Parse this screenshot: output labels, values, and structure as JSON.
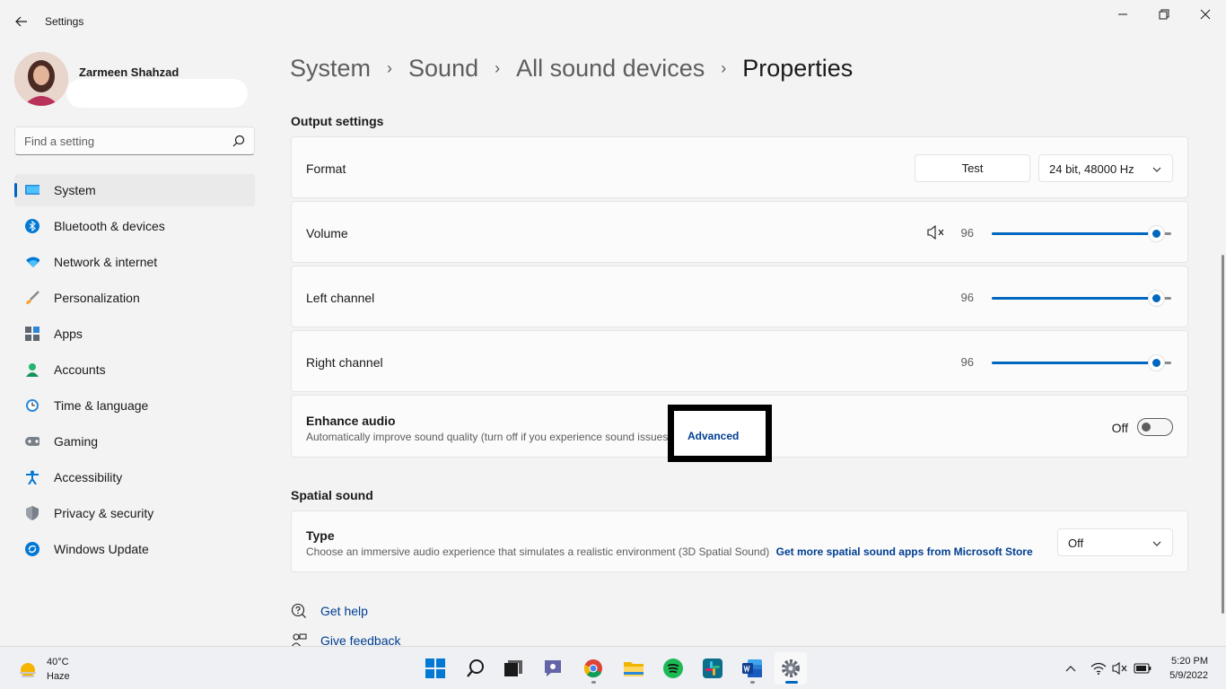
{
  "window": {
    "title": "Settings"
  },
  "profile": {
    "name": "Zarmeen Shahzad"
  },
  "search": {
    "placeholder": "Find a setting"
  },
  "sidebar": {
    "items": [
      {
        "label": "System",
        "icon": "system-icon",
        "active": true
      },
      {
        "label": "Bluetooth & devices",
        "icon": "bluetooth-icon"
      },
      {
        "label": "Network & internet",
        "icon": "wifi-icon"
      },
      {
        "label": "Personalization",
        "icon": "brush-icon"
      },
      {
        "label": "Apps",
        "icon": "apps-icon"
      },
      {
        "label": "Accounts",
        "icon": "accounts-icon"
      },
      {
        "label": "Time & language",
        "icon": "clock-globe-icon"
      },
      {
        "label": "Gaming",
        "icon": "gamepad-icon"
      },
      {
        "label": "Accessibility",
        "icon": "accessibility-icon"
      },
      {
        "label": "Privacy & security",
        "icon": "shield-icon"
      },
      {
        "label": "Windows Update",
        "icon": "update-icon"
      }
    ]
  },
  "breadcrumb": {
    "items": [
      "System",
      "Sound",
      "All sound devices",
      "Properties"
    ],
    "separator": "›"
  },
  "output": {
    "section_title": "Output settings",
    "format": {
      "label": "Format",
      "test_label": "Test",
      "value": "24 bit, 48000 Hz"
    },
    "volume": {
      "label": "Volume",
      "value": "96",
      "level": 96
    },
    "left_channel": {
      "label": "Left channel",
      "value": "96",
      "level": 96
    },
    "right_channel": {
      "label": "Right channel",
      "value": "96",
      "level": 96
    },
    "enhance": {
      "title": "Enhance audio",
      "description": "Automatically improve sound quality (turn off if you experience sound issues)",
      "advanced_link": "Advanced",
      "toggle_label": "Off",
      "on": false
    }
  },
  "spatial": {
    "section_title": "Spatial sound",
    "type": {
      "title": "Type",
      "description": "Choose an immersive audio experience that simulates a realistic environment (3D Spatial Sound)",
      "store_link": "Get more spatial sound apps from Microsoft Store",
      "value": "Off"
    }
  },
  "help": {
    "get_help": "Get help",
    "give_feedback": "Give feedback"
  },
  "taskbar": {
    "weather": {
      "temp": "40°C",
      "condition": "Haze"
    },
    "apps": [
      "start-icon",
      "search-icon",
      "task-view-icon",
      "teams-chat-icon",
      "chrome-icon",
      "file-explorer-icon",
      "spotify-icon",
      "slack-icon",
      "word-icon",
      "settings-icon"
    ],
    "clock": {
      "time": "5:20 PM",
      "date": "5/9/2022"
    }
  },
  "colors": {
    "accent": "#0067c0",
    "link": "#003e92",
    "background": "#f3f3f3",
    "card": "#fbfbfb"
  }
}
